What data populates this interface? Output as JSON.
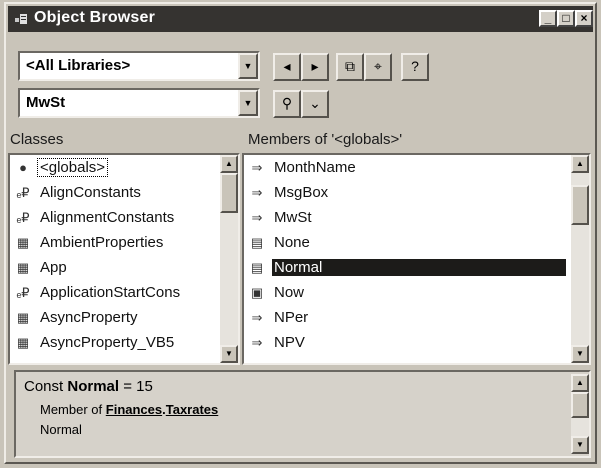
{
  "window": {
    "title": "Object Browser"
  },
  "library_select": {
    "value": "<All Libraries>"
  },
  "search_select": {
    "value": "MwSt"
  },
  "classes": {
    "header": "Classes",
    "items": [
      {
        "label": "<globals>",
        "icon": "globals-icon"
      },
      {
        "label": "AlignConstants",
        "icon": "enum-icon"
      },
      {
        "label": "AlignmentConstants",
        "icon": "enum-icon"
      },
      {
        "label": "AmbientProperties",
        "icon": "class-icon"
      },
      {
        "label": "App",
        "icon": "class-icon"
      },
      {
        "label": "ApplicationStartCons",
        "icon": "enum-icon"
      },
      {
        "label": "AsyncProperty",
        "icon": "class-icon"
      },
      {
        "label": "AsyncProperty_VB5",
        "icon": "class-icon"
      }
    ]
  },
  "members": {
    "header": "Members of '<globals>'",
    "items": [
      {
        "label": "MonthName",
        "icon": "method-icon"
      },
      {
        "label": "MsgBox",
        "icon": "method-icon"
      },
      {
        "label": "MwSt",
        "icon": "method-icon"
      },
      {
        "label": "None",
        "icon": "constant-icon"
      },
      {
        "label": "Normal",
        "icon": "constant-icon"
      },
      {
        "label": "Now",
        "icon": "property-icon"
      },
      {
        "label": "NPer",
        "icon": "method-icon"
      },
      {
        "label": "NPV",
        "icon": "method-icon"
      }
    ]
  },
  "details": {
    "prefix": "Const",
    "name": "Normal",
    "value_text": "= 15",
    "member_of_label": "Member of",
    "library": "Finances",
    "module": "Taxrates",
    "description": "Normal"
  },
  "colors": {
    "titlebar": "#353330",
    "selection": "#1c1b19",
    "face": "#c9c4b9"
  }
}
